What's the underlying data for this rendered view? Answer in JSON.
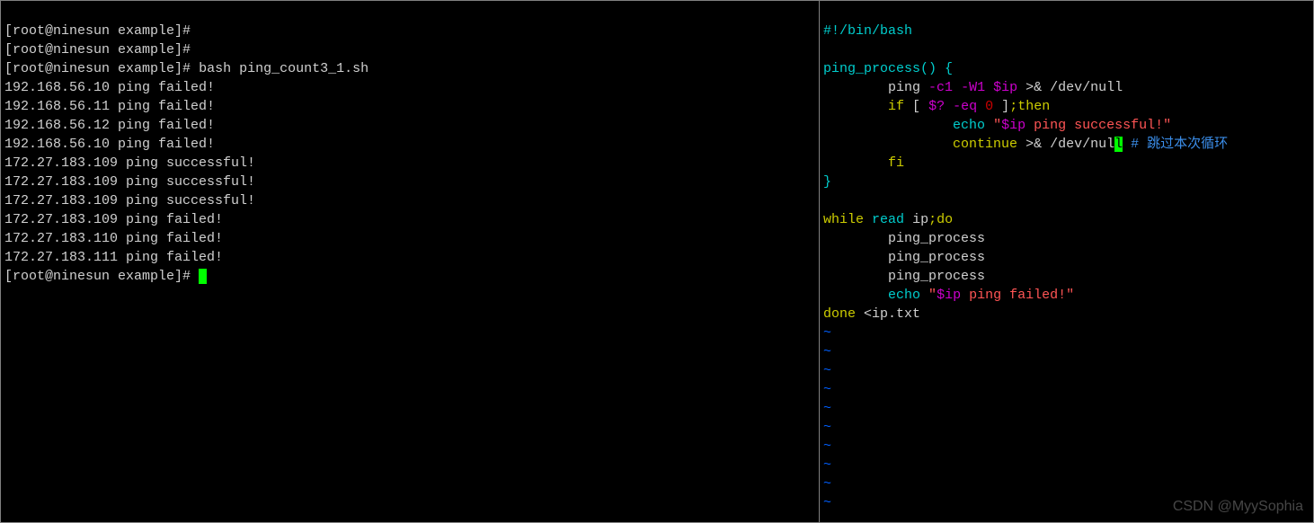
{
  "terminal": {
    "prompt": "[root@ninesun example]#",
    "command": "bash ping_count3_1.sh",
    "output": [
      "192.168.56.10 ping failed!",
      "192.168.56.11 ping failed!",
      "192.168.56.12 ping failed!",
      "192.168.56.10 ping failed!",
      "172.27.183.109 ping successful!",
      "172.27.183.109 ping successful!",
      "172.27.183.109 ping successful!",
      "172.27.183.109 ping failed!",
      "172.27.183.110 ping failed!",
      "172.27.183.111 ping failed!"
    ]
  },
  "editor": {
    "shebang": "#!/bin/bash",
    "func_open": "ping_process() {",
    "ping_cmd": {
      "kw": "ping",
      "opt1": "-c1",
      "opt2": "-W1",
      "var": "$ip",
      "redir": ">&",
      "target": "/dev/null"
    },
    "if_line": {
      "kw": "if",
      "lb": "[",
      "var": "$?",
      "op": "-eq",
      "num": "0",
      "rb": "]",
      "then": ";then"
    },
    "echo_ok": {
      "kw": "echo",
      "q1": "\"",
      "var": "$ip",
      "txt": " ping successful!",
      "q2": "\""
    },
    "continue": {
      "kw": "continue",
      "redir": ">&",
      "target_pre": "/dev/nul",
      "target_cur": "l",
      "comment": "# 跳过本次循环"
    },
    "fi": "fi",
    "func_close": "}",
    "while_line": {
      "kw": "while",
      "read": "read",
      "var": "ip",
      "do": ";do"
    },
    "call": "ping_process",
    "echo_fail": {
      "kw": "echo",
      "q1": "\"",
      "var": "$ip",
      "txt": " ping failed!",
      "q2": "\""
    },
    "done": {
      "kw": "done",
      "redir": "<",
      "file": "ip.txt"
    },
    "tilde": "~"
  },
  "watermark": "CSDN @MyySophia"
}
